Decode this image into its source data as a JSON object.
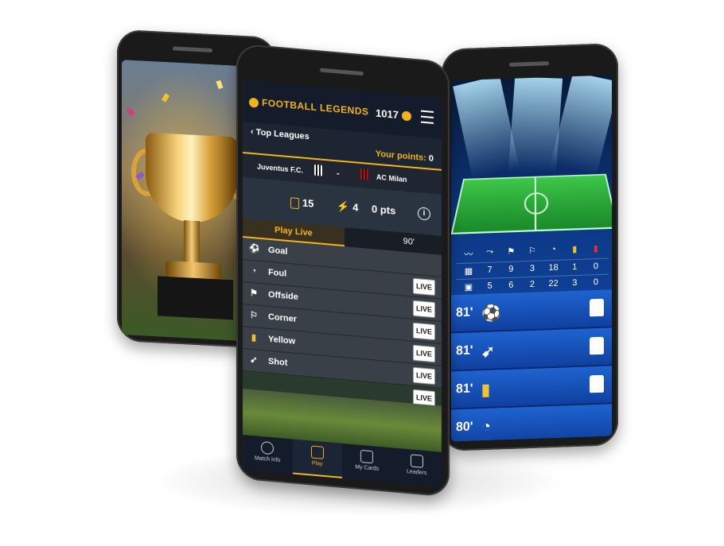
{
  "center_phone": {
    "app_logo": "FOOTBALL LEGENDS",
    "coins": "1017",
    "back_label": "Top Leagues",
    "points_label": "Your points:",
    "points_value": "0",
    "match": {
      "home": "Juventus F.C.",
      "separator": "-",
      "away": "AC Milan"
    },
    "stats": {
      "cards": "15",
      "energy": "4",
      "pts": "0 pts"
    },
    "play_live_tab": "Play Live",
    "minute": "90'",
    "events": [
      {
        "label": "Goal",
        "icon": "ball-icon",
        "live": ""
      },
      {
        "label": "Foul",
        "icon": "whistle-icon",
        "live": "LIVE"
      },
      {
        "label": "Offside",
        "icon": "flag-icon",
        "live": "LIVE"
      },
      {
        "label": "Corner",
        "icon": "corner-flag-icon",
        "live": "LIVE"
      },
      {
        "label": "Yellow",
        "icon": "yellow-card-icon",
        "live": "LIVE"
      },
      {
        "label": "Shot",
        "icon": "boot-icon",
        "live": "LIVE"
      },
      {
        "label": "",
        "icon": "",
        "live": "LIVE"
      }
    ],
    "nav": [
      {
        "label": "Match info",
        "icon": "ball-icon"
      },
      {
        "label": "Play",
        "icon": "card-icon"
      },
      {
        "label": "My Cards",
        "icon": "cards-stack-icon"
      },
      {
        "label": "Leaders",
        "icon": "podium-icon"
      }
    ]
  },
  "right_phone": {
    "stats_rows": [
      [
        "",
        "7",
        "9",
        "3",
        "18",
        "1",
        "0"
      ],
      [
        "",
        "5",
        "6",
        "2",
        "22",
        "3",
        "0"
      ]
    ],
    "events": [
      {
        "minute": "81'",
        "icon": "ball-icon"
      },
      {
        "minute": "81'",
        "icon": "boot-icon"
      },
      {
        "minute": "81'",
        "icon": "yellow-card-icon"
      },
      {
        "minute": "80'",
        "icon": "whistle-icon"
      }
    ]
  },
  "colors": {
    "accent": "#f2b41e",
    "header": "#141c2b",
    "event_row": "#3a4048",
    "live_blue": "#1e63d0"
  }
}
